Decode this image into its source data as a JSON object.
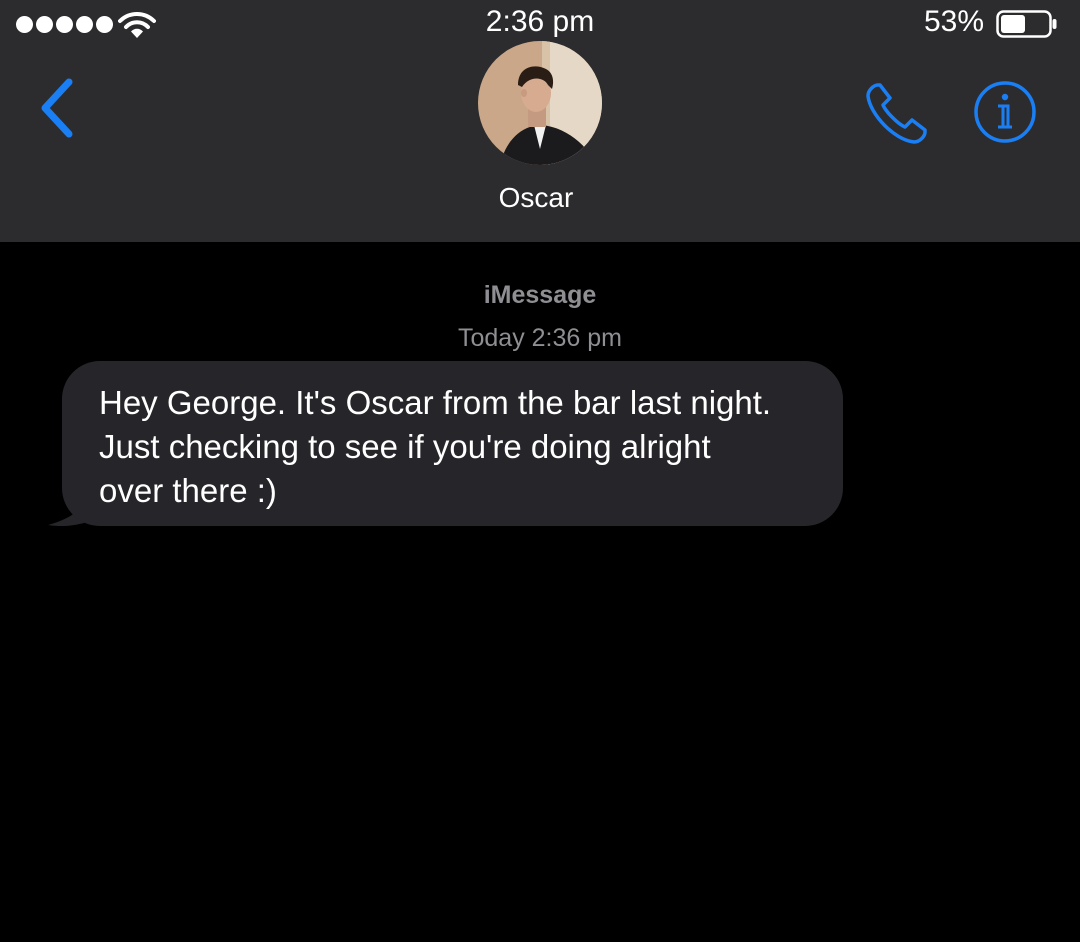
{
  "status_bar": {
    "signal_bars": 5,
    "time": "2:36 pm",
    "battery_percent": "53%",
    "battery_level": 0.53,
    "icons": [
      "signal-dots",
      "wifi-icon",
      "battery-icon"
    ]
  },
  "nav": {
    "contact_name": "Oscar",
    "back_icon": "chevron-left-icon",
    "call_icon": "phone-icon",
    "info_icon": "info-icon",
    "accent_color": "#1a7ff5"
  },
  "conversation": {
    "service_label": "iMessage",
    "timestamp": "Today 2:36 pm",
    "messages": [
      {
        "direction": "incoming",
        "text": "Hey George. It's Oscar from the bar last night.\nJust checking to see if you're doing alright\nover there :)"
      }
    ]
  },
  "colors": {
    "header_bg": "#2c2c2e",
    "screen_bg": "#000000",
    "incoming_bubble": "#26252a",
    "meta_text": "#8e8e93"
  }
}
